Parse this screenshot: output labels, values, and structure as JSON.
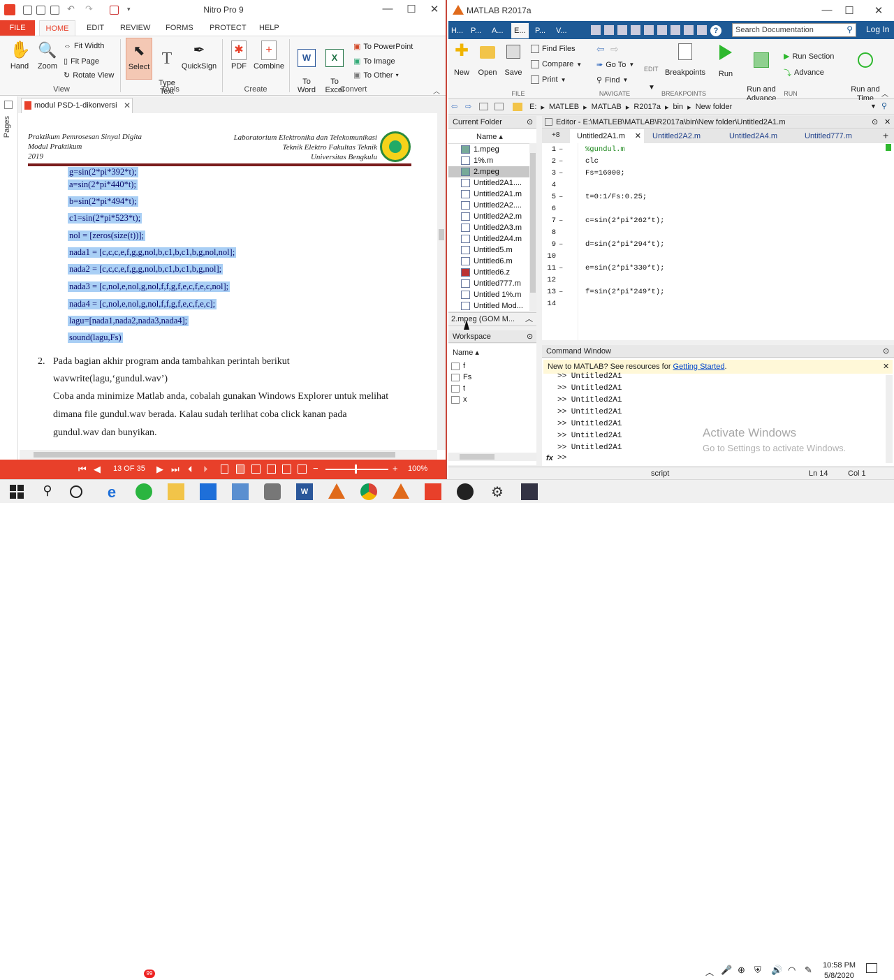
{
  "nitro": {
    "window_title": "Nitro Pro 9",
    "tabs": [
      "FILE",
      "HOME",
      "EDIT",
      "REVIEW",
      "FORMS",
      "PROTECT",
      "HELP"
    ],
    "ribbon": {
      "hand": "Hand",
      "zoom": "Zoom",
      "fit_width": "Fit Width",
      "fit_page": "Fit Page",
      "rotate_view": "Rotate View",
      "view_group": "View",
      "select": "Select",
      "type_text": "Type\nText",
      "quicksign": "QuickSign",
      "tools_group": "Tools",
      "pdf": "PDF",
      "combine": "Combine",
      "create_group": "Create",
      "to_word": "To\nWord",
      "to_excel": "To\nExcel",
      "to_powerpoint": "To PowerPoint",
      "to_image": "To Image",
      "to_other": "To Other",
      "convert_group": "Convert"
    },
    "side_label": "Pages",
    "doc_tab": "modul PSD-1-dikonversi",
    "page": {
      "header_left": [
        "Praktikum Pemrosesan Sinyal Digita",
        "Modul Praktikum",
        "2019"
      ],
      "header_right": [
        "Laboratorium Elektronika dan Telekomunikasi",
        "Teknik Elektro Fakultas Teknik",
        "Universitas Bengkulu"
      ],
      "code_lines": [
        "g=sin(2*pi*392*t);",
        "a=sin(2*pi*440*t);",
        "b=sin(2*pi*494*t);",
        "c1=sin(2*pi*523*t);",
        "nol = [zeros(size(t))];",
        "nada1 = [c,c,c,e,f,g,g,nol,b,c1,b,c1,b,g,nol,nol];",
        "nada2 = [c,c,c,e,f,g,g,nol,b,c1,b,c1,b,g,nol];",
        "nada3 = [c,nol,e,nol,g,nol,f,f,g,f,e,c,f,e,c,nol];",
        "nada4 = [c,nol,e,nol,g,nol,f,f,g,f,e,c,f,e,c];",
        "lagu=[nada1,nada2,nada3,nada4];",
        "sound(lagu,Fs)"
      ],
      "item_number": "2.",
      "para": [
        "Pada bagian akhir program anda tambahkan perintah berikut",
        "wavwrite(lagu,‘gundul.wav’)",
        "Coba anda minimize Matlab anda, cobalah gunakan Windows Explorer untuk melihat",
        "dimana file gundul.wav berada. Kalau sudah terlihat coba click kanan pada",
        "gundul.wav dan bunyikan."
      ]
    },
    "status": {
      "page": "13 OF 35",
      "zoom": "100%"
    }
  },
  "matlab": {
    "window_title": "MATLAB R2017a",
    "tabs": [
      "H...",
      "P...",
      "A...",
      "E...",
      "P...",
      "V..."
    ],
    "search_placeholder": "Search Documentation",
    "login": "Log In",
    "ribbon": {
      "new": "New",
      "open": "Open",
      "save": "Save",
      "find_files": "Find Files",
      "compare": "Compare",
      "print": "Print",
      "file_group": "FILE",
      "go_to": "Go To",
      "find": "Find",
      "navigate_group": "NAVIGATE",
      "edit": "EDIT",
      "breakpoints": "Breakpoints",
      "breakpoints_group": "BREAKPOINTS",
      "run": "Run",
      "run_and_advance": "Run and\nAdvance",
      "run_section": "Run Section",
      "advance": "Advance",
      "run_and_time": "Run and\nTime",
      "run_group": "RUN"
    },
    "path": [
      "E:",
      "MATLEB",
      "MATLAB",
      "R2017a",
      "bin",
      "New folder"
    ],
    "current_folder": {
      "title": "Current Folder",
      "name_col": "Name",
      "files": [
        "1.mpeg",
        "1%.m",
        "2.mpeg",
        "Untitled2A1....",
        "Untitled2A1.m",
        "Untitled2A2....",
        "Untitled2A2.m",
        "Untitled2A3.m",
        "Untitled2A4.m",
        "Untitled5.m",
        "Untitled6.m",
        "Untitled6.z",
        "Untitled777.m",
        "Untitled 1%.m",
        "Untitled Mod..."
      ],
      "details": "2.mpeg  (GOM M..."
    },
    "workspace": {
      "title": "Workspace",
      "name_col": "Name",
      "vars": [
        "f",
        "Fs",
        "t",
        "x"
      ]
    },
    "editor": {
      "title": "Editor - E:\\MATLEB\\MATLAB\\R2017a\\bin\\New folder\\Untitled2A1.m",
      "tabs": [
        "Untitled2A1.m",
        "Untitled2A2.m",
        "Untitled2A4.m",
        "Untitled777.m"
      ],
      "lines": [
        "%gundul.m",
        "clc",
        "Fs=16000;",
        "",
        "t=0:1/Fs:0.25;",
        "",
        "c=sin(2*pi*262*t);",
        "",
        "d=sin(2*pi*294*t);",
        "",
        "e=sin(2*pi*330*t);",
        "",
        "f=sin(2*pi*249*t);",
        ""
      ]
    },
    "command": {
      "title": "Command Window",
      "notice": "New to MATLAB? See resources for ",
      "notice_link": "Getting Started",
      "history": [
        ">> Untitled2A1",
        ">> Untitled2A1",
        ">> Untitled2A1",
        ">> Untitled2A1",
        ">> Untitled2A1",
        ">> Untitled2A1",
        ">> Untitled2A1"
      ],
      "prompt": ">>",
      "fx": "fx"
    },
    "status": {
      "mode": "script",
      "ln": "Ln  14",
      "col": "Col  1"
    },
    "watermark": [
      "Activate Windows",
      "Go to Settings to activate Windows."
    ]
  },
  "taskbar": {
    "time": "10:58 PM",
    "date": "5/8/2020",
    "badge": "99"
  }
}
